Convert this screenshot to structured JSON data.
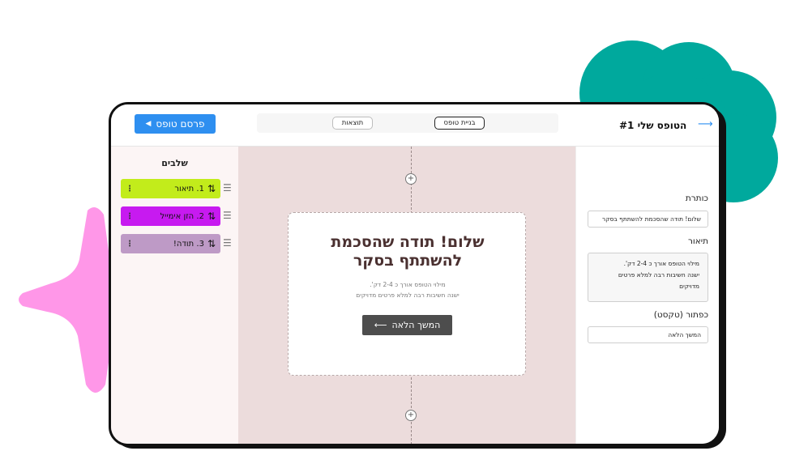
{
  "header": {
    "publish_label": "פרסם טופס",
    "tab_results": "תוצאות",
    "tab_build": "בניית טופס",
    "form_title": "הטופס שלי #1"
  },
  "steps": {
    "title": "שלבים",
    "items": [
      {
        "label": "1. תיאור",
        "color": "#c2ec1b"
      },
      {
        "label": "2. הזן אימייל",
        "color": "#c71af0"
      },
      {
        "label": "3. תודה!",
        "color": "#be9ac6"
      }
    ]
  },
  "canvas": {
    "heading_line1": "שלום! תודה שהסכמת",
    "heading_line2": "להשתתף בסקר",
    "desc_line1": "מילוי הטופס אורך כ 2-4 דק'.",
    "desc_line2": "ישנה חשיבות רבה למלא פרטים מדויקים",
    "next_label": "המשך הלאה",
    "next_arrow": "⟵"
  },
  "properties": {
    "title_label": "כותרת",
    "title_value": "שלום! תודה שהסכמת להשתתף בסקר",
    "desc_label": "תיאור",
    "desc_line1": "מילוי הטופס אורך כ 2-4 דק'.",
    "desc_line2": "ישנה חשיבות רבה למלא פרטים",
    "desc_line3": "מדויקים",
    "button_label": "כפתור (טקסט)",
    "button_value": "המשך הלאה"
  },
  "colors": {
    "accent": "#2e8ff0",
    "teal": "#00a99d",
    "pink": "#ff97e8",
    "canvas_bg": "#ecdcdc"
  },
  "icons": {
    "publish": "play-triangle-icon",
    "back": "arrow-icon",
    "sort": "sort-arrows-icon",
    "kebab": "kebab-menu-icon",
    "drag": "drag-handle-icon",
    "add": "plus-circle-icon"
  }
}
